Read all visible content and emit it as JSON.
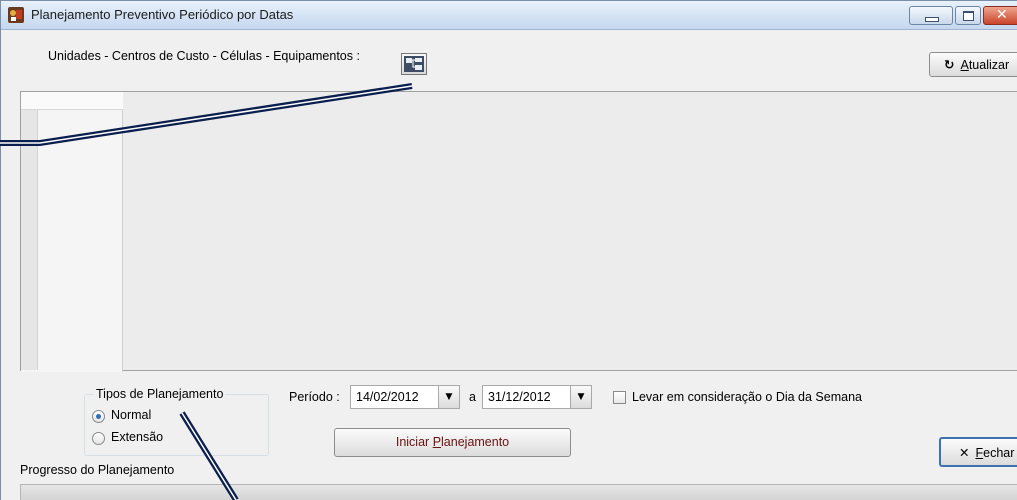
{
  "window": {
    "title": "Planejamento Preventivo Periódico por Datas"
  },
  "toolbar": {
    "scope_label": "Unidades - Centros de Custo - Células - Equipamentos :",
    "refresh_button": {
      "icon": "refresh-icon",
      "mnemonic": "A",
      "rest": "tualizar"
    }
  },
  "planning_types": {
    "title": "Tipos de Planejamento",
    "options": [
      {
        "label": "Normal",
        "selected": true
      },
      {
        "label": "Extensão",
        "selected": false
      }
    ]
  },
  "period": {
    "label": "Período :",
    "from": "14/02/2012",
    "separator": "a",
    "to": "31/12/2012"
  },
  "weekday_option": {
    "label": "Levar em consideração o Dia da Semana",
    "checked": false
  },
  "start_button": {
    "prefix": "Iniciar ",
    "mnemonic": "P",
    "rest": "lanejamento"
  },
  "close_button": {
    "icon": "close-x-icon",
    "mnemonic": "F",
    "rest": "echar"
  },
  "progress": {
    "label": "Progresso do Planejamento",
    "value": 0
  },
  "colors": {
    "title_bar": "#d3e2f4",
    "close_accent": "#c8452b",
    "focus_border": "#3c72b0",
    "annotation_line": "#0a1f4d"
  }
}
